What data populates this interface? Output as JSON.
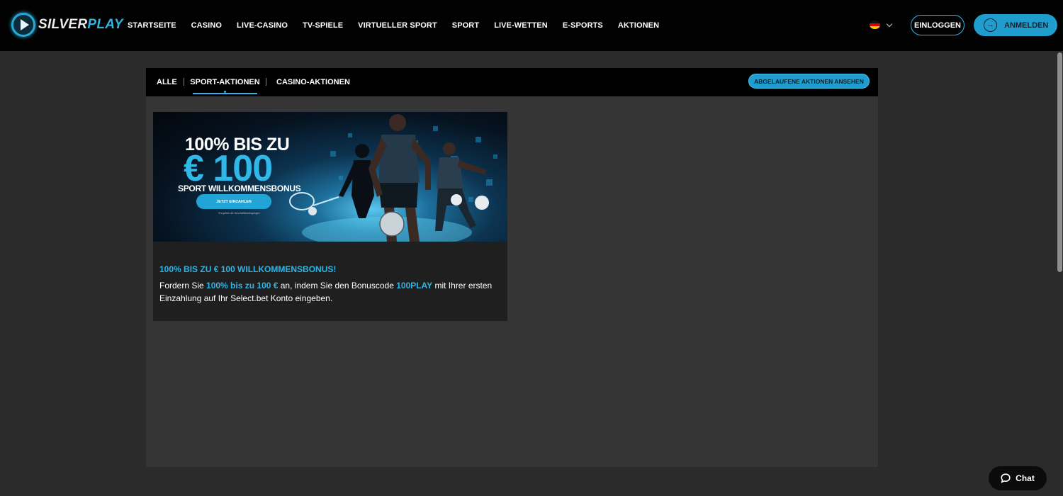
{
  "brand": {
    "name_part1": "SILVER",
    "name_part2": "PLAY"
  },
  "nav": {
    "items": [
      "STARTSEITE",
      "CASINO",
      "LIVE-CASINO",
      "TV-SPIELE",
      "VIRTUELLER SPORT",
      "SPORT",
      "LIVE-WETTEN",
      "E-SPORTS",
      "AKTIONEN"
    ]
  },
  "header": {
    "language_flag": "germany-flag-icon",
    "login_label": "EINLOGGEN",
    "register_label": "ANMELDEN"
  },
  "tabs": {
    "items": [
      "ALLE",
      "SPORT-AKTIONEN",
      "CASINO-AKTIONEN"
    ],
    "active": "SPORT-AKTIONEN",
    "expired_label": "ABGELAUFENE AKTIONEN ANSEHEN"
  },
  "promo": {
    "banner": {
      "headline1": "100% BIS ZU",
      "headline2": "€ 100",
      "sub": "SPORT WILLKOMMENSBONUS",
      "cta": "JETZT EINZAHLEN",
      "fine_print": "*Es gelten die Geschäftsbedingungen"
    },
    "title": "100% BIS ZU € 100 WILLKOMMENSBONUS!",
    "text_1": "Fordern Sie ",
    "text_hl1": "100% bis zu 100 €",
    "text_2": " an, indem Sie den Bonuscode ",
    "text_hl2": "100PLAY",
    "text_3": " mit Ihrer ersten Einzahlung auf Ihr Select.bet Konto eingeben."
  },
  "chat": {
    "label": "Chat"
  },
  "colors": {
    "accent": "#2fb5e5",
    "header_bg": "#020202",
    "page_bg": "#2b2b2b",
    "panel_bg": "#353535"
  }
}
